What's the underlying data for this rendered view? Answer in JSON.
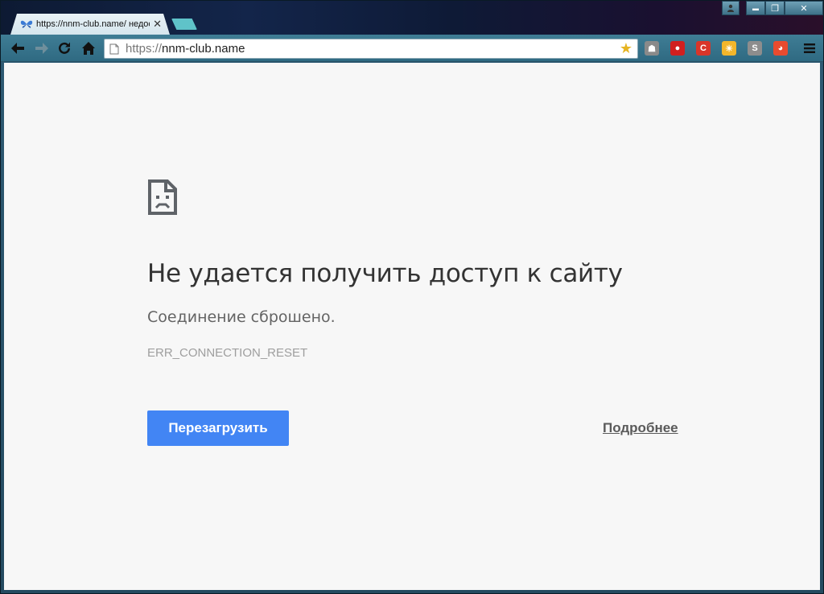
{
  "tab": {
    "title": "https://nnm-club.name/ недоступен",
    "close_glyph": "✕",
    "icon": "butterfly-icon"
  },
  "window_controls": {
    "minimize": "▬",
    "restore": "❐",
    "close": "✕"
  },
  "omnibox": {
    "scheme": "https://",
    "host": "nnm-club.name"
  },
  "extensions": [
    {
      "name": "ghost-ext-icon",
      "glyph": "☗",
      "color": "#8a8a8a"
    },
    {
      "name": "shield-ext-icon",
      "glyph": "●",
      "color": "#d11f1f"
    },
    {
      "name": "c-ext-icon",
      "glyph": "C",
      "color": "#d9352a"
    },
    {
      "name": "weather-ext-icon",
      "glyph": "☀",
      "color": "#f3b62b"
    },
    {
      "name": "s-ext-icon",
      "glyph": "S",
      "color": "#8d8d8d"
    },
    {
      "name": "color-wheel-ext-icon",
      "glyph": "◕",
      "color": "#e84b2f"
    }
  ],
  "error": {
    "title": "Не удается получить доступ к сайту",
    "description": "Соединение сброшено.",
    "code": "ERR_CONNECTION_RESET",
    "reload_label": "Перезагрузить",
    "details_label": "Подробнее"
  },
  "colors": {
    "accent": "#4285f4",
    "background": "#f7f7f7",
    "toolbar": "#3f7d95"
  }
}
